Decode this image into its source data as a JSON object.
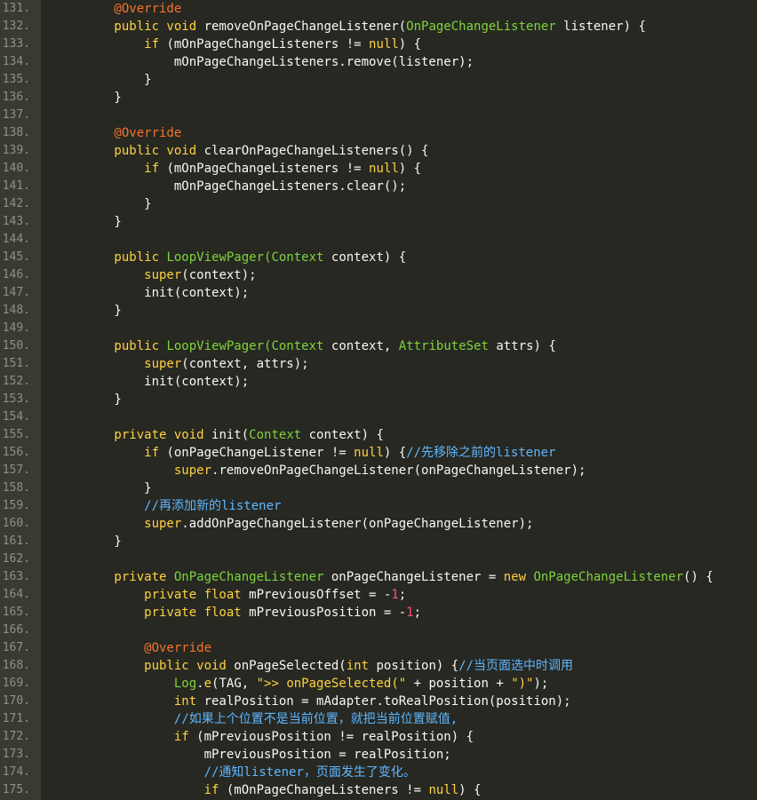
{
  "editor": {
    "theme": {
      "background": "#272822",
      "gutter": "#3b3a32",
      "keyword": "#ffd23f",
      "type": "#7fd43b",
      "annotation": "#f5732a",
      "number": "#ff4f7b",
      "comment": "#5fb7ff"
    },
    "lines": [
      {
        "num": "131.",
        "tokens": [
          [
            "an",
            "        @Override"
          ]
        ]
      },
      {
        "num": "132.",
        "tokens": [
          [
            "kw",
            "        public void "
          ],
          [
            "pl",
            "removeOnPageChangeListener("
          ],
          [
            "ty",
            "OnPageChangeListener"
          ],
          [
            "pl",
            " listener) {"
          ]
        ]
      },
      {
        "num": "133.",
        "tokens": [
          [
            "kw",
            "            if"
          ],
          [
            "pl",
            " (mOnPageChangeListeners != "
          ],
          [
            "kw",
            "null"
          ],
          [
            "pl",
            ") {"
          ]
        ]
      },
      {
        "num": "134.",
        "tokens": [
          [
            "pl",
            "                mOnPageChangeListeners.remove(listener);"
          ]
        ]
      },
      {
        "num": "135.",
        "tokens": [
          [
            "pl",
            "            }"
          ]
        ]
      },
      {
        "num": "136.",
        "tokens": [
          [
            "pl",
            "        }"
          ]
        ]
      },
      {
        "num": "137.",
        "tokens": []
      },
      {
        "num": "138.",
        "tokens": [
          [
            "an",
            "        @Override"
          ]
        ]
      },
      {
        "num": "139.",
        "tokens": [
          [
            "kw",
            "        public void "
          ],
          [
            "pl",
            "clearOnPageChangeListeners() {"
          ]
        ]
      },
      {
        "num": "140.",
        "tokens": [
          [
            "kw",
            "            if"
          ],
          [
            "pl",
            " (mOnPageChangeListeners != "
          ],
          [
            "kw",
            "null"
          ],
          [
            "pl",
            ") {"
          ]
        ]
      },
      {
        "num": "141.",
        "tokens": [
          [
            "pl",
            "                mOnPageChangeListeners.clear();"
          ]
        ]
      },
      {
        "num": "142.",
        "tokens": [
          [
            "pl",
            "            }"
          ]
        ]
      },
      {
        "num": "143.",
        "tokens": [
          [
            "pl",
            "        }"
          ]
        ]
      },
      {
        "num": "144.",
        "tokens": []
      },
      {
        "num": "145.",
        "tokens": [
          [
            "kw",
            "        public "
          ],
          [
            "ty",
            "LoopViewPager("
          ],
          [
            "ty",
            "Context"
          ],
          [
            "pl",
            " context) {"
          ]
        ]
      },
      {
        "num": "146.",
        "tokens": [
          [
            "kw",
            "            super"
          ],
          [
            "pl",
            "(context);"
          ]
        ]
      },
      {
        "num": "147.",
        "tokens": [
          [
            "pl",
            "            init(context);"
          ]
        ]
      },
      {
        "num": "148.",
        "tokens": [
          [
            "pl",
            "        }"
          ]
        ]
      },
      {
        "num": "149.",
        "tokens": []
      },
      {
        "num": "150.",
        "tokens": [
          [
            "kw",
            "        public "
          ],
          [
            "ty",
            "LoopViewPager("
          ],
          [
            "ty",
            "Context"
          ],
          [
            "pl",
            " context, "
          ],
          [
            "ty",
            "AttributeSet"
          ],
          [
            "pl",
            " attrs) {"
          ]
        ]
      },
      {
        "num": "151.",
        "tokens": [
          [
            "kw",
            "            super"
          ],
          [
            "pl",
            "(context, attrs);"
          ]
        ]
      },
      {
        "num": "152.",
        "tokens": [
          [
            "pl",
            "            init(context);"
          ]
        ]
      },
      {
        "num": "153.",
        "tokens": [
          [
            "pl",
            "        }"
          ]
        ]
      },
      {
        "num": "154.",
        "tokens": []
      },
      {
        "num": "155.",
        "tokens": [
          [
            "kw",
            "        private void "
          ],
          [
            "pl",
            "init("
          ],
          [
            "ty",
            "Context"
          ],
          [
            "pl",
            " context) {"
          ]
        ]
      },
      {
        "num": "156.",
        "tokens": [
          [
            "kw",
            "            if"
          ],
          [
            "pl",
            " (onPageChangeListener != "
          ],
          [
            "kw",
            "null"
          ],
          [
            "pl",
            ") {"
          ],
          [
            "cm",
            "//先移除之前的listener"
          ]
        ]
      },
      {
        "num": "157.",
        "tokens": [
          [
            "kw",
            "                super"
          ],
          [
            "pl",
            ".removeOnPageChangeListener(onPageChangeListener);"
          ]
        ]
      },
      {
        "num": "158.",
        "tokens": [
          [
            "pl",
            "            }"
          ]
        ]
      },
      {
        "num": "159.",
        "tokens": [
          [
            "cm",
            "            //再添加新的listener"
          ]
        ]
      },
      {
        "num": "160.",
        "tokens": [
          [
            "kw",
            "            super"
          ],
          [
            "pl",
            ".addOnPageChangeListener(onPageChangeListener);"
          ]
        ]
      },
      {
        "num": "161.",
        "tokens": [
          [
            "pl",
            "        }"
          ]
        ]
      },
      {
        "num": "162.",
        "tokens": []
      },
      {
        "num": "163.",
        "tokens": [
          [
            "kw",
            "        private "
          ],
          [
            "ty",
            "OnPageChangeListener"
          ],
          [
            "pl",
            " onPageChangeListener = "
          ],
          [
            "kw",
            "new "
          ],
          [
            "ty",
            "OnPageChangeListener"
          ],
          [
            "pl",
            "() {"
          ]
        ]
      },
      {
        "num": "164.",
        "tokens": [
          [
            "kw",
            "            private float "
          ],
          [
            "pl",
            "mPreviousOffset = -"
          ],
          [
            "nu",
            "1"
          ],
          [
            "pl",
            ";"
          ]
        ]
      },
      {
        "num": "165.",
        "tokens": [
          [
            "kw",
            "            private float "
          ],
          [
            "pl",
            "mPreviousPosition = -"
          ],
          [
            "nu",
            "1"
          ],
          [
            "pl",
            ";"
          ]
        ]
      },
      {
        "num": "166.",
        "tokens": []
      },
      {
        "num": "167.",
        "tokens": [
          [
            "an",
            "            @Override"
          ]
        ]
      },
      {
        "num": "168.",
        "tokens": [
          [
            "kw",
            "            public void "
          ],
          [
            "pl",
            "onPageSelected("
          ],
          [
            "kw",
            "int"
          ],
          [
            "pl",
            " position) {"
          ],
          [
            "cm",
            "//当页面选中时调用"
          ]
        ]
      },
      {
        "num": "169.",
        "tokens": [
          [
            "ty",
            "                Log"
          ],
          [
            "pl",
            "."
          ],
          [
            "kw",
            "e"
          ],
          [
            "pl",
            "(TAG, "
          ],
          [
            "st",
            "\">> onPageSelected(\""
          ],
          [
            "pl",
            " + position + "
          ],
          [
            "st",
            "\")\""
          ],
          [
            "pl",
            ");"
          ]
        ]
      },
      {
        "num": "170.",
        "tokens": [
          [
            "kw",
            "                int "
          ],
          [
            "pl",
            "realPosition = mAdapter.toRealPosition(position);"
          ]
        ]
      },
      {
        "num": "171.",
        "tokens": [
          [
            "cm",
            "                //如果上个位置不是当前位置，就把当前位置赋值,"
          ]
        ]
      },
      {
        "num": "172.",
        "tokens": [
          [
            "kw",
            "                if"
          ],
          [
            "pl",
            " (mPreviousPosition != realPosition) {"
          ]
        ]
      },
      {
        "num": "173.",
        "tokens": [
          [
            "pl",
            "                    mPreviousPosition = realPosition;"
          ]
        ]
      },
      {
        "num": "174.",
        "tokens": [
          [
            "cm",
            "                    //通知listener，页面发生了变化。"
          ]
        ]
      },
      {
        "num": "175.",
        "tokens": [
          [
            "kw",
            "                    if"
          ],
          [
            "pl",
            " (mOnPageChangeListeners != "
          ],
          [
            "kw",
            "null"
          ],
          [
            "pl",
            ") {"
          ]
        ]
      }
    ]
  }
}
